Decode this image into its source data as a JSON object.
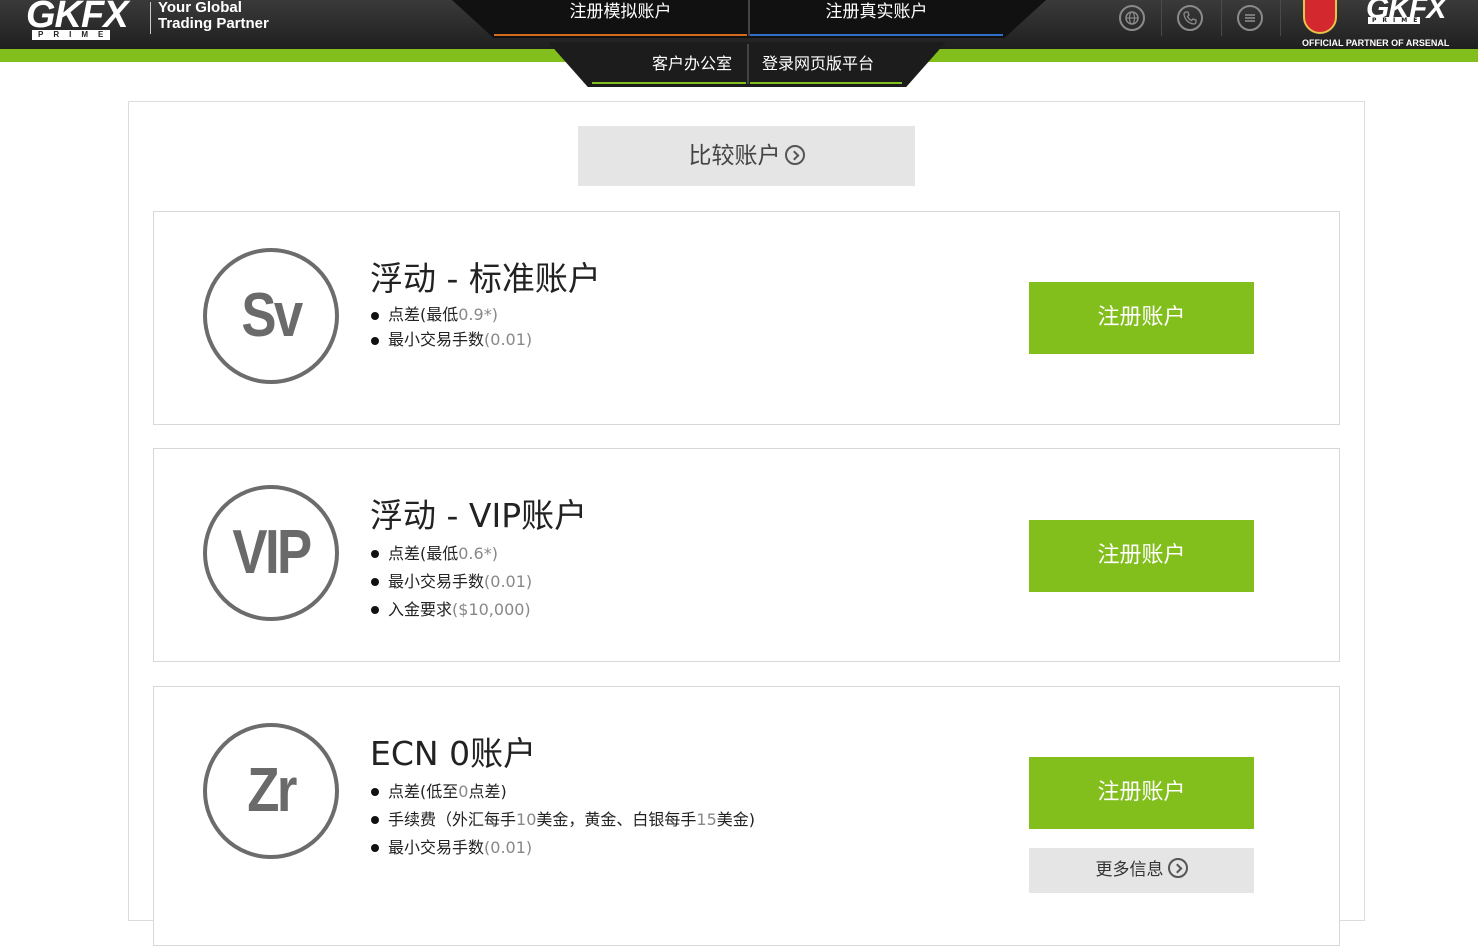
{
  "header": {
    "logo": "GKFX",
    "logo_sub": "PRIME",
    "tagline_line1": "Your Global",
    "tagline_line2": "Trading Partner",
    "nav_top": {
      "demo": "注册模拟账户",
      "real": "注册真实账户"
    },
    "nav_bottom": {
      "office": "客户办公室",
      "web_platform": "登录网页版平台"
    },
    "icons": [
      "globe-icon",
      "phone-icon",
      "menu-icon"
    ],
    "partner_logo": "GKFX",
    "partner_logo_sub": "PRIME",
    "partner_text": "OFFICIAL PARTNER OF ARSENAL",
    "colors": {
      "green_bar": "#82bf1c",
      "demo_underline": "#d46a1c",
      "real_underline": "#2f6fc9"
    }
  },
  "compare": {
    "label": "比较账户"
  },
  "accounts": [
    {
      "badge": "Sv",
      "title": "浮动 - 标准账户",
      "features": [
        {
          "label": "点差(最低",
          "value": "0.9*)"
        },
        {
          "label": "最小交易手数",
          "value": "(0.01)"
        }
      ],
      "button": "注册账户"
    },
    {
      "badge": "VIP",
      "title": "浮动 - VIP账户",
      "features": [
        {
          "label": "点差(最低",
          "value": "0.6*)"
        },
        {
          "label": "最小交易手数",
          "value": "(0.01)"
        },
        {
          "label": "入金要求",
          "value": "($10,000)"
        }
      ],
      "button": "注册账户"
    },
    {
      "badge": "Zr",
      "title": "ECN 0账户",
      "features": [
        {
          "label": "点差(低至",
          "value": "0",
          "label2": "点差)"
        },
        {
          "label": "手续费（外汇每手",
          "value": "10",
          "label2": "美金，黄金、白银每手",
          "value2": "15",
          "label3": "美金)"
        },
        {
          "label": "最小交易手数",
          "value": "(0.01)"
        }
      ],
      "button": "注册账户",
      "more": "更多信息"
    }
  ],
  "brand_colors": {
    "register_button": "#82bf1c",
    "secondary_button": "#e5e5e5",
    "badge_gray": "#6c6c6c"
  }
}
